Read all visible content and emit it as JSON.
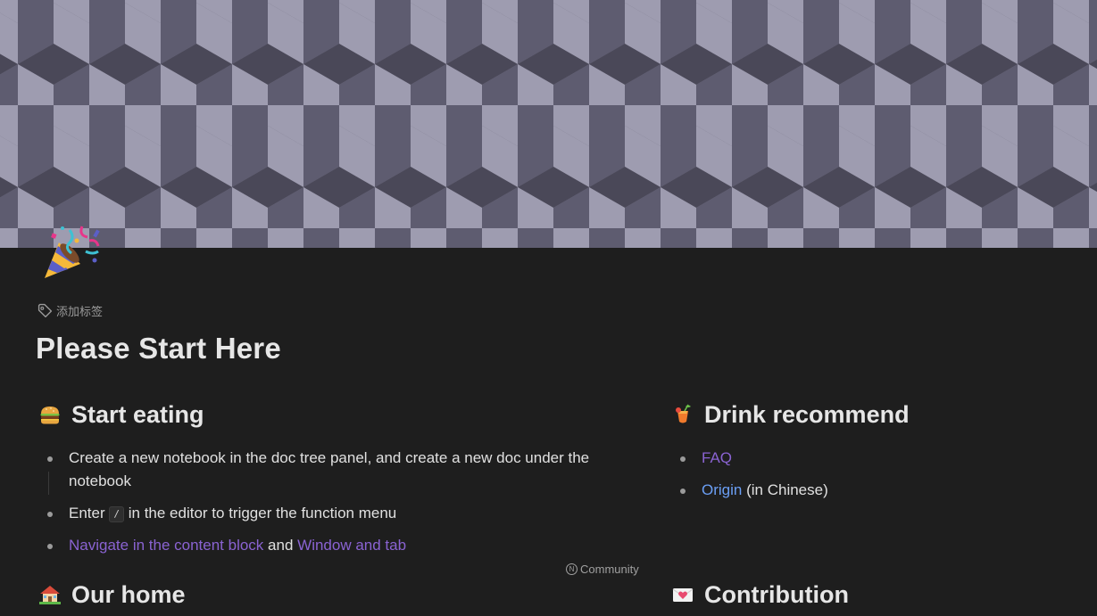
{
  "document": {
    "title": "Please Start Here",
    "add_tag_label": "添加标签",
    "banner": {
      "pattern": "isometric-cubes",
      "colors": [
        "#4a4858",
        "#5e5c70",
        "#9e9cb0"
      ]
    },
    "icon": "party-popper-icon"
  },
  "sections": {
    "start_eating": {
      "icon": "hamburger-icon",
      "heading": "Start eating",
      "items": {
        "item1": {
          "text": "Create a new notebook in the doc tree panel, and create a new doc under the notebook"
        },
        "item2": {
          "before": "Enter",
          "kbd": "/",
          "after": "in the editor to trigger the function menu"
        },
        "item3": {
          "link1": "Navigate in the content block",
          "middle": "and",
          "link2": "Window and tab"
        }
      }
    },
    "drink_recommend": {
      "icon": "tropical-drink-icon",
      "heading": "Drink recommend",
      "items": {
        "faq": {
          "link": "FAQ"
        },
        "origin": {
          "link": "Origin",
          "suffix": "(in Chinese)"
        }
      }
    },
    "our_home": {
      "icon": "house-with-garden-icon",
      "heading": "Our home"
    },
    "contribution": {
      "icon": "love-letter-icon",
      "heading": "Contribution"
    }
  },
  "community_badge": {
    "label": "Community",
    "badge_letter": "N"
  },
  "colors": {
    "background": "#1e1e1e",
    "link_purple": "#8a63d2",
    "link_blue": "#6b9ff5",
    "heading": "#e6e6e6"
  }
}
